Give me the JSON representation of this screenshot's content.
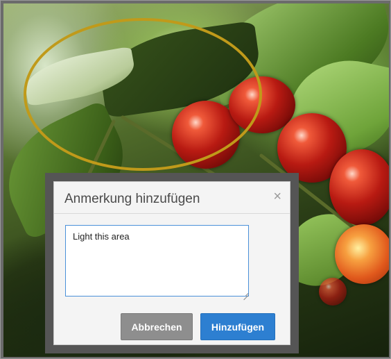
{
  "dialog": {
    "title": "Anmerkung hinzufügen",
    "close_glyph": "×",
    "note_text": "Light this area",
    "cancel_label": "Abbrechen",
    "add_label": "Hinzufügen"
  },
  "colors": {
    "annotation_ellipse": "#c09a1a",
    "primary_button": "#2d7fd1",
    "secondary_button": "#8e8e8e"
  },
  "icons": {
    "close": "close-icon",
    "resize": "resize-grip-icon"
  }
}
